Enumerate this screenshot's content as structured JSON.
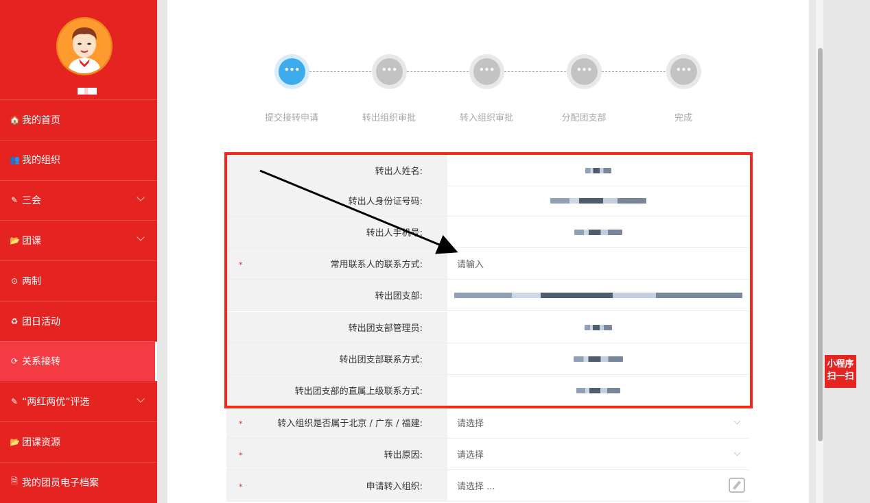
{
  "sidebar": {
    "items": [
      {
        "icon": "🏠",
        "label": "我的首页",
        "icon_name": "home-icon",
        "has_chevron": false,
        "active": false
      },
      {
        "icon": "👥",
        "label": "我的组织",
        "icon_name": "group-icon",
        "has_chevron": false,
        "active": false
      },
      {
        "icon": "✎",
        "label": "三会",
        "icon_name": "edit-icon",
        "has_chevron": true,
        "active": false
      },
      {
        "icon": "📂",
        "label": "团课",
        "icon_name": "folder-open-icon",
        "has_chevron": true,
        "active": false
      },
      {
        "icon": "⊙",
        "label": "两制",
        "icon_name": "dot-circle-icon",
        "has_chevron": false,
        "active": false
      },
      {
        "icon": "♻",
        "label": "团日活动",
        "icon_name": "recycle-icon",
        "has_chevron": false,
        "active": false
      },
      {
        "icon": "⟳",
        "label": "关系接转",
        "icon_name": "refresh-icon",
        "has_chevron": false,
        "active": true
      },
      {
        "icon": "✎",
        "label": "“两红两优”评选",
        "icon_name": "edit-icon",
        "has_chevron": true,
        "active": false
      },
      {
        "icon": "📂",
        "label": "团课资源",
        "icon_name": "folder-open-icon",
        "has_chevron": false,
        "active": false
      },
      {
        "icon": "🗎",
        "label": "我的团员电子档案",
        "icon_name": "file-icon",
        "has_chevron": false,
        "active": false
      }
    ]
  },
  "steps": [
    {
      "label": "提交接转申请",
      "symbol": "•••",
      "active": true
    },
    {
      "label": "转出组织审批",
      "symbol": "•••",
      "active": false
    },
    {
      "label": "转入组织审批",
      "symbol": "•••",
      "active": false
    },
    {
      "label": "分配团支部",
      "symbol": "•••",
      "active": false
    },
    {
      "label": "完成",
      "symbol": "•••",
      "active": false
    }
  ],
  "form": {
    "rows": [
      {
        "label": "转出人姓名:",
        "required": false,
        "value": "",
        "placeholder": "",
        "kind": "blurred"
      },
      {
        "label": "转出人身份证号码:",
        "required": false,
        "value": "",
        "placeholder": "",
        "kind": "blurred"
      },
      {
        "label": "转出人手机号:",
        "required": false,
        "value": "",
        "placeholder": "",
        "kind": "blurred"
      },
      {
        "label": "常用联系人的联系方式:",
        "required": true,
        "value": "",
        "placeholder": "请输入",
        "kind": "input"
      },
      {
        "label": "转出团支部:",
        "required": false,
        "value": "",
        "placeholder": "",
        "kind": "blurred"
      },
      {
        "label": "转出团支部管理员:",
        "required": false,
        "value": "",
        "placeholder": "",
        "kind": "blurred"
      },
      {
        "label": "转出团支部联系方式:",
        "required": false,
        "value": "",
        "placeholder": "",
        "kind": "blurred"
      },
      {
        "label": "转出团支部的直属上级联系方式:",
        "required": false,
        "value": "",
        "placeholder": "",
        "kind": "blurred"
      },
      {
        "label": "转入组织是否属于北京 / 广东 / 福建:",
        "required": true,
        "value": "",
        "placeholder": "请选择",
        "kind": "select"
      },
      {
        "label": "转出原因:",
        "required": true,
        "value": "",
        "placeholder": "请选择",
        "kind": "select"
      },
      {
        "label": "申请转入组织:",
        "required": true,
        "value": "",
        "placeholder": "请选择 ...",
        "kind": "picker"
      }
    ],
    "required_mark": "*"
  },
  "floating": {
    "line1": "小程序",
    "line2": "扫一扫"
  },
  "colors": {
    "brand_red": "#e52421",
    "active_step": "#3eabee",
    "highlight_box": "#f22a1a"
  }
}
